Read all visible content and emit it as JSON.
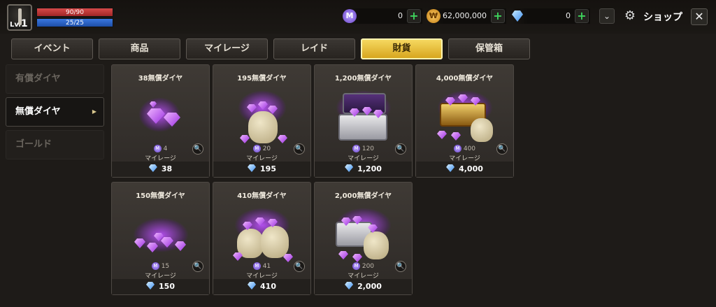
{
  "player": {
    "level_prefix": "Lv.",
    "level": "1",
    "hp": "90/90",
    "mp": "25/25"
  },
  "currencies": [
    {
      "icon": "mileage-icon",
      "symbol": "M",
      "value": "0"
    },
    {
      "icon": "gold-coin-icon",
      "symbol": "₩",
      "value": "62,000,000"
    },
    {
      "icon": "diamond-icon",
      "symbol": "",
      "value": "0"
    }
  ],
  "header": {
    "title": "ショップ",
    "dropdown": "⌄",
    "close": "✕",
    "shop_icon": "⚙"
  },
  "tabs": [
    {
      "label": "イベント",
      "active": false
    },
    {
      "label": "商品",
      "active": false
    },
    {
      "label": "マイレージ",
      "active": false
    },
    {
      "label": "レイド",
      "active": false
    },
    {
      "label": "財貨",
      "active": true
    },
    {
      "label": "保管箱",
      "active": false
    }
  ],
  "sidebar": [
    {
      "label": "有償ダイヤ",
      "active": false
    },
    {
      "label": "無償ダイヤ",
      "active": true,
      "arrow": "▶"
    },
    {
      "label": "ゴールド",
      "active": false
    }
  ],
  "products": [
    {
      "name": "38無償ダイヤ",
      "mileage": "4",
      "mileage_label": "マイレージ",
      "price": "38",
      "art": "gems"
    },
    {
      "name": "195無償ダイヤ",
      "mileage": "20",
      "mileage_label": "マイレージ",
      "price": "195",
      "art": "bag"
    },
    {
      "name": "1,200無償ダイヤ",
      "mileage": "120",
      "mileage_label": "マイレージ",
      "price": "1,200",
      "art": "silver-chest"
    },
    {
      "name": "4,000無償ダイヤ",
      "mileage": "400",
      "mileage_label": "マイレージ",
      "price": "4,000",
      "art": "gold-chest"
    },
    {
      "name": "150無償ダイヤ",
      "mileage": "15",
      "mileage_label": "マイレージ",
      "price": "150",
      "art": "gem-pile"
    },
    {
      "name": "410無償ダイヤ",
      "mileage": "41",
      "mileage_label": "マイレージ",
      "price": "410",
      "art": "bags"
    },
    {
      "name": "2,000無償ダイヤ",
      "mileage": "200",
      "mileage_label": "マイレージ",
      "price": "2,000",
      "art": "chest-bags"
    }
  ],
  "labels": {
    "mileage_symbol": "M",
    "zoom": "🔍"
  },
  "colors": {
    "active_tab": "#f0cc4a",
    "hp": "#c93434",
    "mp": "#2e66cc",
    "plus": "#3ed35c"
  }
}
